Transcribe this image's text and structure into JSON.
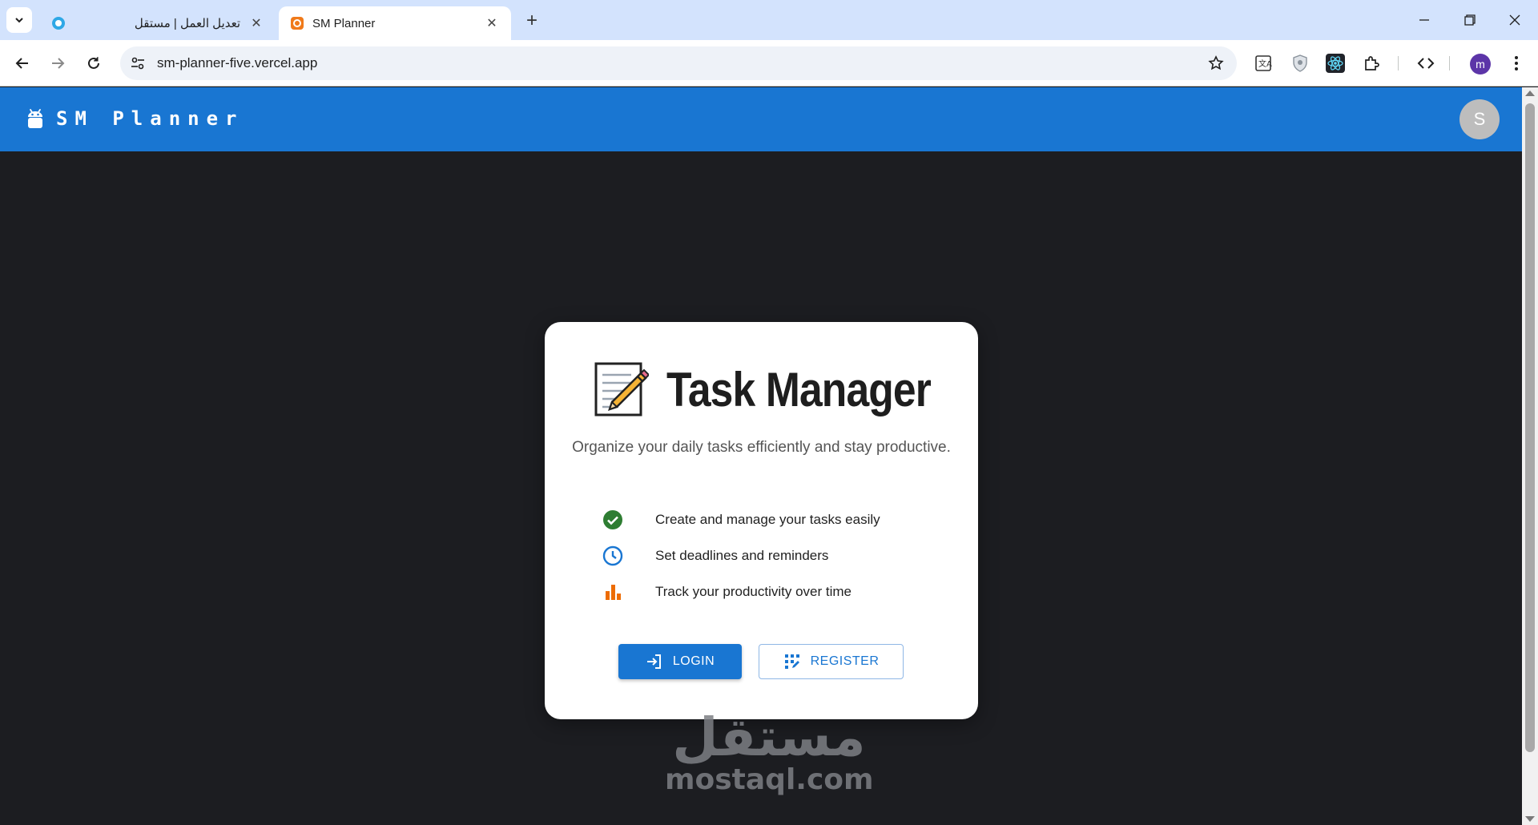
{
  "browser": {
    "tabs": [
      {
        "title": "تعديل العمل | مستقل",
        "active": false
      },
      {
        "title": "SM Planner",
        "active": true
      }
    ],
    "new_tab_label": "+",
    "url": "sm-planner-five.vercel.app",
    "profile_initial": "m"
  },
  "app": {
    "brand": "SM Planner",
    "user_initial": "S",
    "brand_color": "#1976d2",
    "background_color": "#1c1d21"
  },
  "card": {
    "emoji_icon": "memo-icon",
    "title": "Task Manager",
    "subtitle": "Organize your daily tasks efficiently and stay productive.",
    "features": [
      {
        "icon": "check-circle-icon",
        "color": "#2e7d32",
        "text": "Create and manage your tasks easily"
      },
      {
        "icon": "clock-icon",
        "color": "#1976d2",
        "text": "Set deadlines and reminders"
      },
      {
        "icon": "bar-chart-icon",
        "color": "#ed6c02",
        "text": "Track your productivity over time"
      }
    ],
    "login_label": "LOGIN",
    "register_label": "REGISTER"
  },
  "watermark": {
    "arabic": "مستقل",
    "latin": "mostaql.com"
  }
}
